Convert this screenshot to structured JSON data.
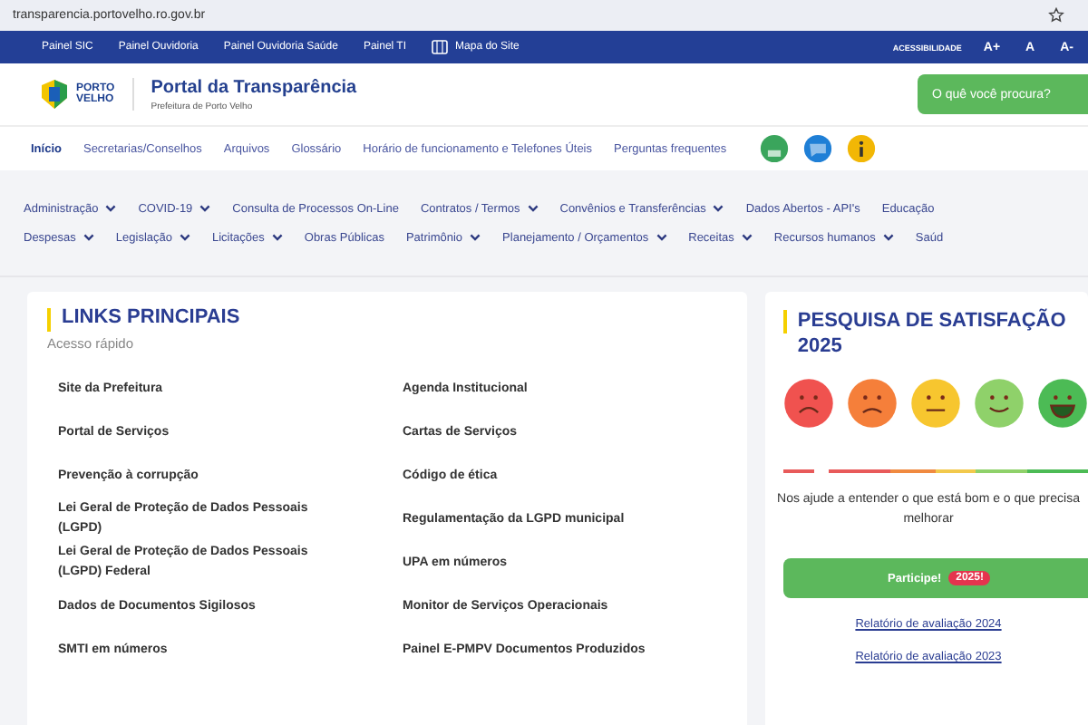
{
  "browser": {
    "url": "transparencia.portovelho.ro.gov.br"
  },
  "top_bar": {
    "links": [
      {
        "label": "Painel SIC",
        "kind": "text"
      },
      {
        "label": "Painel Ouvidoria",
        "kind": "text"
      },
      {
        "label": "Painel Ouvidoria Saúde",
        "kind": "text"
      },
      {
        "label": "Painel TI",
        "kind": "text"
      },
      {
        "label": "Mapa do Site",
        "kind": "map"
      }
    ],
    "accessibility": {
      "label": "ACESSIBILIDADE",
      "buttons": [
        "A+",
        "A",
        "A-"
      ]
    }
  },
  "header": {
    "logo_text": [
      "PORTO",
      "VELHO"
    ],
    "title": "Portal da Transparência",
    "subtitle": "Prefeitura de Porto Velho",
    "search_button": "O quê você procura?"
  },
  "nav": {
    "items": [
      {
        "label": "Início",
        "selected": true
      },
      {
        "label": "Secretarias/Conselhos",
        "selected": false
      },
      {
        "label": "Arquivos",
        "selected": false
      },
      {
        "label": "Glossário",
        "selected": false
      },
      {
        "label": "Horário de funcionamento e Telefones Úteis",
        "selected": false
      },
      {
        "label": "Perguntas frequentes",
        "selected": false
      }
    ],
    "icons": [
      {
        "kind": "chat",
        "color": "#3aa55c"
      },
      {
        "kind": "message",
        "color": "#1f7fd6"
      },
      {
        "kind": "info",
        "color": "#f2b705"
      }
    ]
  },
  "menu_rows": [
    [
      {
        "label": "Administração",
        "dropdown": true
      },
      {
        "label": "COVID-19",
        "dropdown": true
      },
      {
        "label": "Consulta de Processos On-Line",
        "dropdown": false
      },
      {
        "label": "Contratos / Termos",
        "dropdown": true
      },
      {
        "label": "Convênios e Transferências",
        "dropdown": true
      },
      {
        "label": "Dados Abertos - API's",
        "dropdown": false
      },
      {
        "label": "Educação",
        "dropdown": false
      }
    ],
    [
      {
        "label": "Despesas",
        "dropdown": true
      },
      {
        "label": "Legislação",
        "dropdown": true
      },
      {
        "label": "Licitações",
        "dropdown": true
      },
      {
        "label": "Obras Públicas",
        "dropdown": false
      },
      {
        "label": "Patrimônio",
        "dropdown": true
      },
      {
        "label": "Planejamento / Orçamentos",
        "dropdown": true
      },
      {
        "label": "Receitas",
        "dropdown": true
      },
      {
        "label": "Recursos humanos",
        "dropdown": true
      },
      {
        "label": "Saúd",
        "dropdown": false
      }
    ]
  ],
  "links_card": {
    "title": "LINKS PRINCIPAIS",
    "subtitle": "Acesso rápido",
    "links": [
      [
        "Site da Prefeitura",
        "Agenda Institucional"
      ],
      [
        "Portal de Serviços",
        "Cartas de Serviços"
      ],
      [
        "Prevenção à corrupção",
        "Código de ética"
      ],
      [
        "Lei Geral de Proteção de Dados Pessoais (LGPD)",
        "Regulamentação da LGPD municipal"
      ],
      [
        "Lei Geral de Proteção de Dados Pessoais (LGPD) Federal",
        "UPA em números"
      ],
      [
        "Dados de Documentos Sigilosos",
        "Monitor de Serviços Operacionais"
      ],
      [
        "SMTI em números",
        "Painel E-PMPV Documentos Produzidos"
      ]
    ]
  },
  "survey_card": {
    "title": "PESQUISA DE SATISFAÇÃO 2025",
    "faces": [
      {
        "kind": "very-sad",
        "color": "#f0524f"
      },
      {
        "kind": "sad",
        "color": "#f57f3a"
      },
      {
        "kind": "neutral",
        "color": "#f7c62f"
      },
      {
        "kind": "smile",
        "color": "#8fd16a"
      },
      {
        "kind": "grin",
        "color": "#4cbb55"
      }
    ],
    "text": "Nos ajude a entender o que está bom e o que precisa melhorar",
    "button": {
      "label": "Participe!",
      "badge": "2025!"
    },
    "reports": [
      "Relatório de avaliação 2024",
      "Relatório de avaliação 2023"
    ]
  }
}
